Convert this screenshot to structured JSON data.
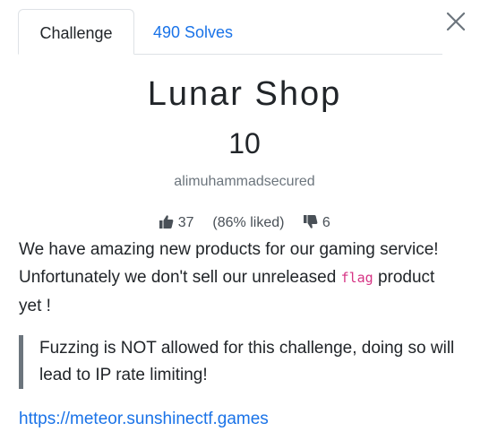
{
  "tabs": {
    "challenge": "Challenge",
    "solves": "490 Solves"
  },
  "close_icon": "close-icon",
  "challenge": {
    "name": "Lunar Shop",
    "value": "10",
    "author": "alimuhammadsecured"
  },
  "votes": {
    "likes": "37",
    "liked_pct": "(86% liked)",
    "dislikes": "6"
  },
  "description": {
    "line1": "We have amazing new products for our gaming service!",
    "line2_before": "Unfortunately we don't sell our unreleased ",
    "line2_code": "flag",
    "line2_after": " product",
    "line3": "yet !"
  },
  "note": "Fuzzing is NOT allowed for this challenge, doing so will lead to IP rate limiting!",
  "link": "https://meteor.sunshinectf.games",
  "colors": {
    "accent": "#1a73e8",
    "code": "#d63384",
    "muted": "#6c757d"
  }
}
